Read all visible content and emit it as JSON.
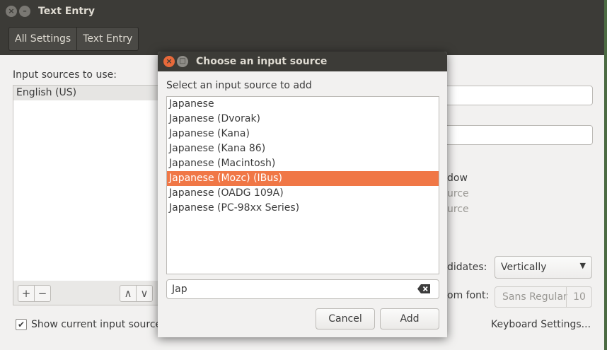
{
  "window": {
    "title": "Text Entry",
    "breadcrumbs": [
      "All Settings",
      "Text Entry"
    ]
  },
  "main": {
    "sources_label": "Input sources to use:",
    "sources": [
      "English (US)"
    ],
    "tools": {
      "add": "+",
      "remove": "−",
      "up": "∧",
      "down": "∨"
    },
    "show_current_label": "Show current input source",
    "show_current_checked": "✔",
    "right_fragments": {
      "window": "dow",
      "source1": "urce",
      "source2": "urce",
      "candidates_label": "didates:",
      "font_label": "om font:"
    },
    "candidates_value": "Vertically",
    "font": {
      "name": "Sans Regular",
      "size": "10"
    },
    "keyboard_settings": "Keyboard Settings..."
  },
  "dialog": {
    "title": "Choose an input source",
    "prompt": "Select an input source to add",
    "options": [
      "Japanese",
      "Japanese (Dvorak)",
      "Japanese (Kana)",
      "Japanese (Kana 86)",
      "Japanese (Macintosh)",
      "Japanese (Mozc) (IBus)",
      "Japanese (OADG 109A)",
      "Japanese (PC-98xx Series)"
    ],
    "selected_index": 5,
    "search_value": "Jap",
    "cancel_label": "Cancel",
    "add_label": "Add"
  },
  "colors": {
    "accent": "#f07746",
    "titlebar": "#3c3b37",
    "close_button": "#e8693a"
  }
}
